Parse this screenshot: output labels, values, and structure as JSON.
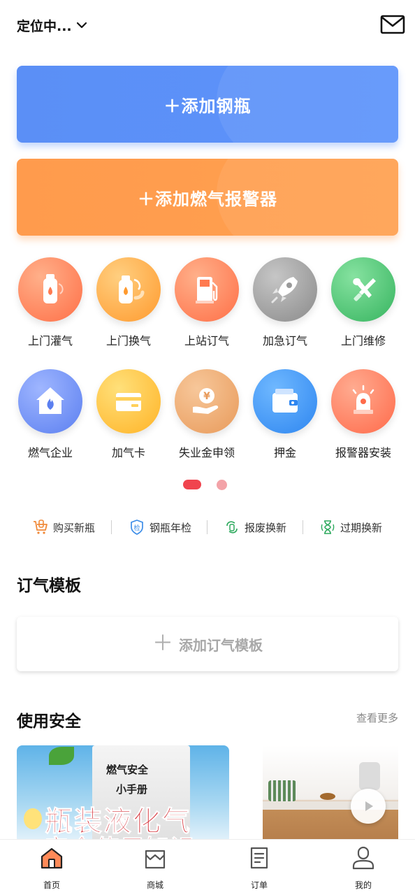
{
  "header": {
    "location": "定位中...",
    "icons": {
      "dropdown": "chevron-down-icon",
      "message": "mail-icon"
    }
  },
  "actions": {
    "add_cylinder": "添加钢瓶",
    "add_alarm": "添加燃气报警器",
    "colors": {
      "add_cylinder": "#5b8ff6",
      "add_alarm": "#ff9b4d"
    }
  },
  "services": [
    {
      "label": "上门灌气",
      "icon": "gas-cylinder-icon"
    },
    {
      "label": "上门换气",
      "icon": "cylinder-exchange-icon"
    },
    {
      "label": "上站订气",
      "icon": "gas-station-icon"
    },
    {
      "label": "加急订气",
      "icon": "rocket-icon"
    },
    {
      "label": "上门维修",
      "icon": "tools-icon"
    },
    {
      "label": "燃气企业",
      "icon": "flame-house-icon"
    },
    {
      "label": "加气卡",
      "icon": "card-icon"
    },
    {
      "label": "失业金申领",
      "icon": "yuan-coin-hand-icon"
    },
    {
      "label": "押金",
      "icon": "wallet-icon"
    },
    {
      "label": "报警器安装",
      "icon": "alarm-siren-icon"
    }
  ],
  "pager": {
    "pages": 2,
    "current": 1
  },
  "quick_links": [
    {
      "label": "购买新瓶",
      "icon": "cart-icon"
    },
    {
      "label": "钢瓶年检",
      "icon": "inspection-icon"
    },
    {
      "label": "报废换新",
      "icon": "recycle-icon"
    },
    {
      "label": "过期换新",
      "icon": "hourglass-icon"
    }
  ],
  "order_template": {
    "title": "订气模板",
    "add_label": "添加订气模板"
  },
  "safety": {
    "title": "使用安全",
    "more": "查看更多",
    "banner1": {
      "line1": "燃气安全",
      "line2": "小手册",
      "line3": "瓶装液化气",
      "line4": "安全使用知识"
    },
    "banner2_icon": "play-icon"
  },
  "tabs": [
    {
      "label": "首页",
      "icon": "home-icon",
      "active": true
    },
    {
      "label": "商城",
      "icon": "shop-icon",
      "active": false
    },
    {
      "label": "订单",
      "icon": "order-icon",
      "active": false
    },
    {
      "label": "我的",
      "icon": "user-icon",
      "active": false
    }
  ]
}
